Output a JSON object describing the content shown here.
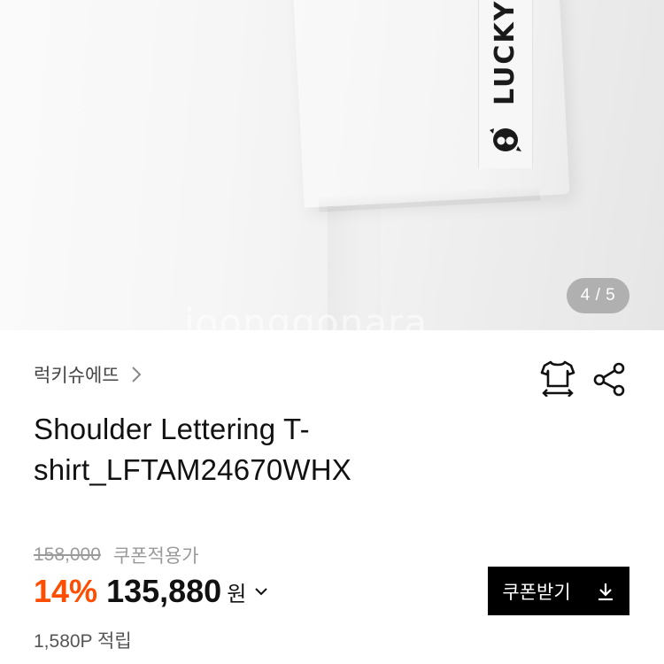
{
  "image": {
    "sleeve_text": "LUCKY",
    "counter": "4 / 5",
    "watermark": "joonggonara"
  },
  "product": {
    "brand": "럭키슈에뜨",
    "title": "Shoulder Lettering T-shirt_LFTAM24670WHX"
  },
  "price": {
    "original": "158,000",
    "original_label": "쿠폰적용가",
    "discount": "14%",
    "sale": "135,880",
    "currency": "원"
  },
  "coupon": {
    "label": "쿠폰받기"
  },
  "points": "1,580P 적립",
  "icons": {
    "brand_chevron": "chevron-right-icon",
    "size": "tshirt-size-icon",
    "share": "share-icon",
    "price_chevron": "chevron-down-icon",
    "download": "download-icon"
  },
  "colors": {
    "discount": "#ff4d00",
    "coupon_button_bg": "#000000",
    "strike_text": "#9a9a9a"
  }
}
